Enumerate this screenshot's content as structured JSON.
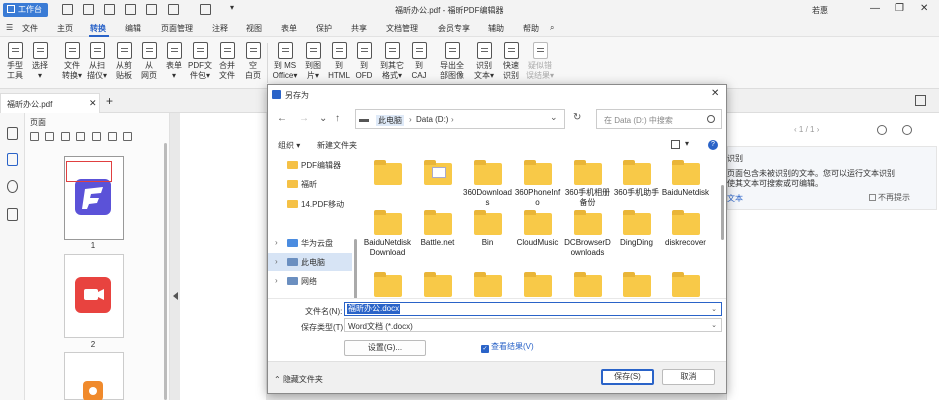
{
  "titlebar": {
    "workbench": "工作台",
    "doc_title": "福昕办公.pdf - 福昕PDF编辑器",
    "user": "若惠",
    "minimize": "—",
    "restore": "❐",
    "close": "✕"
  },
  "menu": {
    "file": "文件",
    "items": [
      "主页",
      "转换",
      "编辑",
      "页面管理",
      "注释",
      "视图",
      "表单",
      "保护",
      "共享",
      "文档管理",
      "会员专享",
      "辅助",
      "帮助"
    ],
    "active": "转换"
  },
  "ribbon": {
    "buttons": [
      {
        "l1": "手型",
        "l2": "工具"
      },
      {
        "l1": "选择",
        "l2": "▾"
      },
      {
        "l1": "文件",
        "l2": "转换▾"
      },
      {
        "l1": "从扫",
        "l2": "描仪▾"
      },
      {
        "l1": "从剪",
        "l2": "贴板"
      },
      {
        "l1": "从",
        "l2": "网页"
      },
      {
        "l1": "表单",
        "l2": "▾"
      },
      {
        "l1": "PDF文",
        "l2": "件包▾"
      },
      {
        "l1": "合并",
        "l2": "文件"
      },
      {
        "l1": "空",
        "l2": "白页"
      },
      {
        "l1": "到 MS",
        "l2": "Office▾"
      },
      {
        "l1": "到图",
        "l2": "片▾"
      },
      {
        "l1": "到",
        "l2": "HTML"
      },
      {
        "l1": "到",
        "l2": "OFD"
      },
      {
        "l1": "到其它",
        "l2": "格式▾"
      },
      {
        "l1": "到",
        "l2": "CAJ"
      },
      {
        "l1": "导出全",
        "l2": "部图像"
      },
      {
        "l1": "识别",
        "l2": "文本▾"
      },
      {
        "l1": "快速",
        "l2": "识别"
      },
      {
        "l1": "疑似错",
        "l2": "误结果▾"
      }
    ]
  },
  "tabs": {
    "doc_tab": "福昕办公.pdf",
    "close": "✕",
    "new": "+"
  },
  "thumbs": {
    "title": "页面",
    "pages": [
      "1",
      "2"
    ]
  },
  "ocr": {
    "pager": "1 / 1",
    "title": "识别",
    "line1": "页面包含未被识别的文本。您可以运行文本识别",
    "line2": "使其文本可搜索或可编辑。",
    "link": "文本",
    "noshow": "不再提示"
  },
  "dialog": {
    "title": "另存为",
    "close": "✕",
    "nav": {
      "back": "←",
      "forward": "→",
      "down": "⌄",
      "up": "↑",
      "dropdown": "⌄",
      "refresh": "↻"
    },
    "address": {
      "pc": "此电脑",
      "drive": "Data (D:)",
      "sep": "›"
    },
    "search_placeholder": "在 Data (D:) 中搜索",
    "organize": "组织 ▾",
    "new_folder": "新建文件夹",
    "view_drop": "▾",
    "help": "?",
    "nav_items": [
      {
        "label": "PDF编辑器",
        "expand": "",
        "icon": "folder"
      },
      {
        "label": "福昕",
        "expand": "",
        "icon": "folder"
      },
      {
        "label": "14.PDF移动",
        "expand": "",
        "icon": "folder"
      },
      {
        "label": "华为云盘",
        "expand": "›",
        "icon": "cloud"
      },
      {
        "label": "此电脑",
        "expand": "›",
        "icon": "pc"
      },
      {
        "label": "网络",
        "expand": "›",
        "icon": "net"
      }
    ],
    "files": [
      {
        "name": "",
        "doc": false
      },
      {
        "name": "",
        "doc": true
      },
      {
        "name": "360Downloads",
        "doc": false
      },
      {
        "name": "360PhoneInfo",
        "doc": false
      },
      {
        "name": "360手机相册备份",
        "doc": false
      },
      {
        "name": "360手机助手",
        "doc": false
      },
      {
        "name": "BaiduNetdisk",
        "doc": false
      },
      {
        "name": "BaiduNetdiskDownload",
        "doc": false
      },
      {
        "name": "Battle.net",
        "doc": false
      },
      {
        "name": "Bin",
        "doc": false
      },
      {
        "name": "CloudMusic",
        "doc": false
      },
      {
        "name": "DCBrowserDownloads",
        "doc": false
      },
      {
        "name": "DingDing",
        "doc": false
      },
      {
        "name": "diskrecover",
        "doc": false
      },
      {
        "name": "",
        "doc": false
      },
      {
        "name": "",
        "doc": false
      },
      {
        "name": "",
        "doc": false
      },
      {
        "name": "",
        "doc": false
      },
      {
        "name": "",
        "doc": false
      },
      {
        "name": "",
        "doc": false
      },
      {
        "name": "",
        "doc": false
      }
    ],
    "filename_label": "文件名(N):",
    "filename_value": "福昕办公.docx",
    "filetype_label": "保存类型(T):",
    "filetype_value": "Word文档 (*.docx)",
    "settings": "设置(G)...",
    "view_result": "查看结果(V)",
    "hide_folders": "隐藏文件夹",
    "save": "保存(S)",
    "cancel": "取消"
  }
}
